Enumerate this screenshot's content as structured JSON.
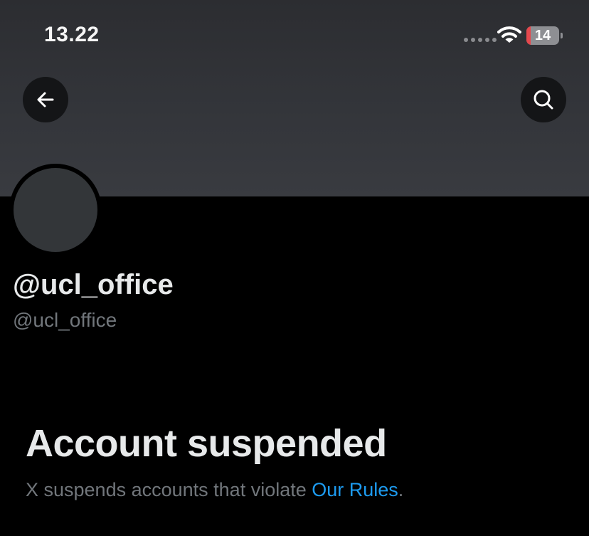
{
  "status_bar": {
    "time": "13.22",
    "battery_level": "14",
    "battery_fraction": 0.14,
    "low_battery_color": "#e5484d"
  },
  "header": {
    "back_icon": "arrow-left-icon",
    "search_icon": "search-icon"
  },
  "profile": {
    "display_name": "@ucl_office",
    "handle": "@ucl_office",
    "avatar_color": "#333639"
  },
  "notice": {
    "title": "Account suspended",
    "message_prefix": "X suspends accounts that violate ",
    "link_text": "Our Rules",
    "message_suffix": ".",
    "link_color": "#1d9bf0"
  },
  "colors": {
    "background": "#000000",
    "banner": "#36383d",
    "text_primary": "#e7e9ea",
    "text_secondary": "#71767b"
  }
}
